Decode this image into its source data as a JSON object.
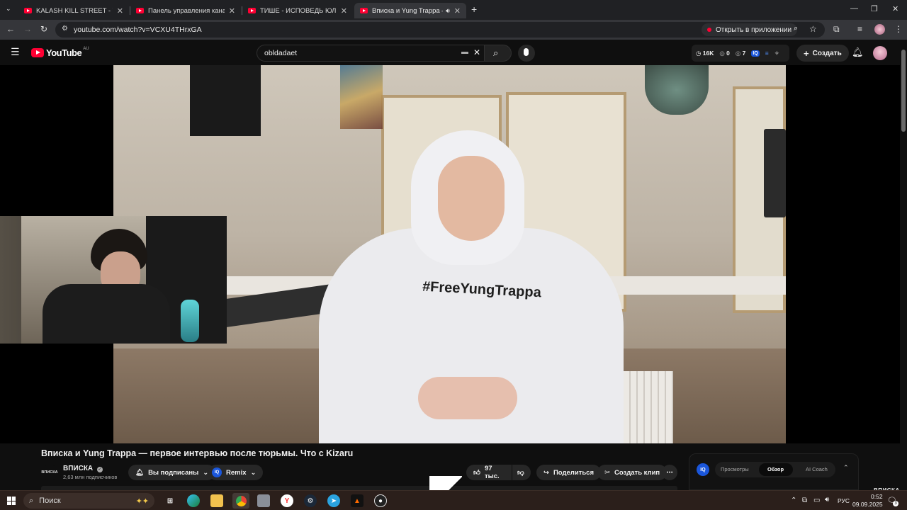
{
  "browser": {
    "tabs": [
      {
        "title": "KALASH KILL STREET - YouTube",
        "active": false
      },
      {
        "title": "Панель управления каналом - YouTube",
        "active": false
      },
      {
        "title": "ТИШЕ - ИСПОВЕДЬ ЮЛИ ФИНЕСС",
        "active": false
      },
      {
        "title": "Вписка и Yung Trappa — пе",
        "active": true
      }
    ],
    "url": "youtube.com/watch?v=VCXU4THrxGA",
    "open_in_app_label": "Открыть в приложении"
  },
  "yt_header": {
    "logo_text": "YouTube",
    "country_code": "AU",
    "search_value": "obldadaet",
    "stats": {
      "views": "16K",
      "likes": "0",
      "comments": "7",
      "ext_badge": "IQ"
    },
    "create_label": "Создать"
  },
  "player": {
    "hoodie_text": "#FreeYungTrappa",
    "watermark": "ВПИСКА"
  },
  "video": {
    "title": "Вписка и Yung Trappa — первое интервью после тюрьмы. Что с Kizaru",
    "channel_name": "ВПИСКА",
    "channel_logo_text": "ВПИСКА",
    "subscribers": "2,63 млн подписчиков",
    "subscribed_label": "Вы подписаны",
    "remix_label": "Remix",
    "remix_badge": "IQ",
    "likes": "97 тыс.",
    "share_label": "Поделиться",
    "clip_label": "Создать клип"
  },
  "ai_panel": {
    "badge": "IQ",
    "tabs": [
      "Просмотры",
      "Обзор",
      "AI Coach"
    ],
    "active_tab": "Обзор"
  },
  "taskbar": {
    "search_label": "Поиск",
    "language": "РУС",
    "time": "0:52",
    "date": "09.09.2025",
    "notification_count": "3"
  },
  "colors": {
    "yt_red": "#ff0033",
    "bg": "#0f0f0f",
    "pill": "#272727",
    "iq_blue": "#1a56db"
  }
}
